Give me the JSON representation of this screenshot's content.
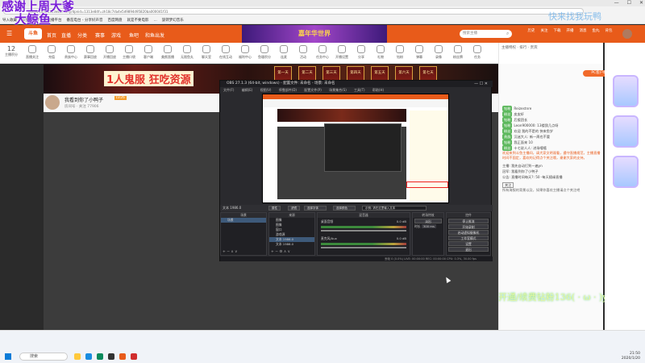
{
  "overlay": {
    "line1": "感谢上周大爹",
    "line2": "大鲸鱼",
    "faint": "快来找我玩鸭",
    "promo": "开通/续费钻粉136( · ω · )y"
  },
  "browser": {
    "url": "douyu.com/1313e84f...zhy/dpnid=1313e84f=zh18c7da4e5d9894d95820ba000041f31",
    "bookmarks": [
      "导入收藏",
      "斗鱼 - 每个人的直播平台",
      "番茄电台 - 分享好声音",
      "百度网盘",
      "就是不要电影",
      "...",
      "旋转梦幻音乐"
    ],
    "controls": [
      "—",
      "☐",
      "✕"
    ]
  },
  "nav": {
    "logo": "斗鱼",
    "links": [
      "首页",
      "直播",
      "分类",
      "赛事",
      "游戏",
      "鱼吧",
      "和鱼出发"
    ],
    "event": "嘉年华世界",
    "search_placeholder": "搜索主播",
    "icons": [
      "历史",
      "关注",
      "下载",
      "开播",
      "消息",
      "鱼丸",
      "背包"
    ]
  },
  "categories": [
    {
      "name": "主播积分",
      "num": "12"
    },
    {
      "name": "直播关注"
    },
    {
      "name": "充值"
    },
    {
      "name": "贵族中心"
    },
    {
      "name": "赛事回放"
    },
    {
      "name": "开播回放"
    },
    {
      "name": "主播口袋"
    },
    {
      "name": "客户端"
    },
    {
      "name": "美颜直播"
    },
    {
      "name": "无限鱼丸"
    },
    {
      "name": "聊天室"
    },
    {
      "name": "在线互动"
    },
    {
      "name": "福利中心"
    },
    {
      "name": "鱼塘积分"
    },
    {
      "name": "连麦"
    },
    {
      "name": "活动"
    },
    {
      "name": "任务中心"
    },
    {
      "name": "开播设置"
    },
    {
      "name": "分享"
    },
    {
      "name": "礼物"
    },
    {
      "name": "钻粉"
    },
    {
      "name": "弹幕"
    },
    {
      "name": "录像"
    },
    {
      "name": "粉丝牌"
    },
    {
      "name": "任务"
    },
    {
      "name": "更多"
    }
  ],
  "banner": {
    "title": "1人鬼服 狂吃资源",
    "days": [
      "第一天",
      "第二天",
      "第三天",
      "第四天",
      "第五天",
      "第六天",
      "第七天"
    ]
  },
  "streamer": {
    "name": "我看到你了小鸭子",
    "level": "LV26",
    "meta": "房间号 · 关注 77906"
  },
  "obs": {
    "title": "OBS 27.1.3 (64-bit, windows) - 配置文件: 未命名 - 场景: 未命名",
    "menu": [
      "文件(F)",
      "编辑(E)",
      "视图(V)",
      "停靠部件(D)",
      "配置文件(P)",
      "场景集合(S)",
      "工具(T)",
      "帮助(H)"
    ],
    "toolbar_text": "文本  1986.0",
    "toolbar_buttons": [
      "属性",
      "滤镜",
      "选择字体",
      "选择颜色",
      "示例: 请在这里输入文本"
    ],
    "scenes_header": "场景",
    "scenes": [
      "场景"
    ],
    "sources_header": "来源",
    "sources": [
      "图像",
      "图像",
      "窗口",
      "游戏源",
      "文本 1986.0",
      "文本 1986.0"
    ],
    "mixer_header": "混音器",
    "mixer": [
      {
        "name": "桌面音频",
        "value": "0.0 dB"
      },
      {
        "name": "麦克风/Aux",
        "value": "0.0 dB"
      }
    ],
    "transition_header": "转场特效",
    "transition": {
      "type": "淡出",
      "duration_label": "时长",
      "duration": "300 ms"
    },
    "controls_header": "控件",
    "controls": [
      "停止推流",
      "开始录制",
      "启动虚拟摄像机",
      "工作室模式",
      "设置",
      "退出"
    ],
    "status": "丢帧 0 (0.0%)   LIVE: 00:00:00   REC: 00:00:00   CPU: 0.3%, 30.00 fps"
  },
  "sidebar": {
    "header": "主播特权 · 排行 · 贵宾",
    "pc_button": "PC客户端",
    "chat": [
      {
        "badge": "钻粉",
        "text": "Reizestnre"
      },
      {
        "badge": "粉丝",
        "text": "皮皮虾"
      },
      {
        "badge": "钻粉",
        "text": "后援团长"
      },
      {
        "badge": "钻粉",
        "text": "Leon900000: 13楼我几点呀"
      },
      {
        "badge": "粉丝",
        "text": "欢迎 我的不是的 快来鱼岁"
      },
      {
        "badge": "贵族",
        "text": "沉迷大人: 新一周也不要"
      },
      {
        "badge": "钻粉",
        "text": "我正面来 10"
      },
      {
        "badge": "粉丝",
        "text": "十七说人人: 进场嘻嘻"
      }
    ],
    "system_msg": "欢迎来到斗鱼主播间，请大家文明观看，遵守直播规范，主播直播时间不固定，喜欢的记得点个关注哦，谢谢大家的支持。",
    "announce": [
      "主播: 我先自动打到一遍yn",
      "冠军: 我看到你了小鸭子",
      "公告: 直播时间每天?: 50 -每天随缘直播"
    ],
    "follow_btn": "关注",
    "follow_note": "所有海报的背景以及，如果你喜欢主播请点个关注吧"
  },
  "taskbar": {
    "search": "搜索",
    "time": "21:50",
    "date": "2020/1/20"
  }
}
